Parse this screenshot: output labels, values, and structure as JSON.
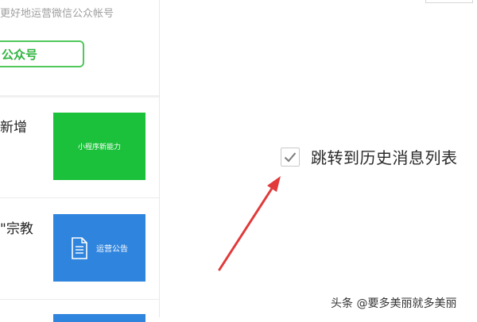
{
  "left_panel": {
    "subtitle": "更好地运营微信公众帐号",
    "account_button": "公众号",
    "items": [
      {
        "text": "新增",
        "thumb_label": "小程序新能力"
      },
      {
        "text": "\"宗教",
        "thumb_label": "运营公告"
      }
    ]
  },
  "checkbox": {
    "label": "跳转到历史消息列表",
    "checked": true
  },
  "annotation": {
    "arrow_color": "#e23a3a"
  },
  "watermark": "头条 @要多美丽就多美丽"
}
